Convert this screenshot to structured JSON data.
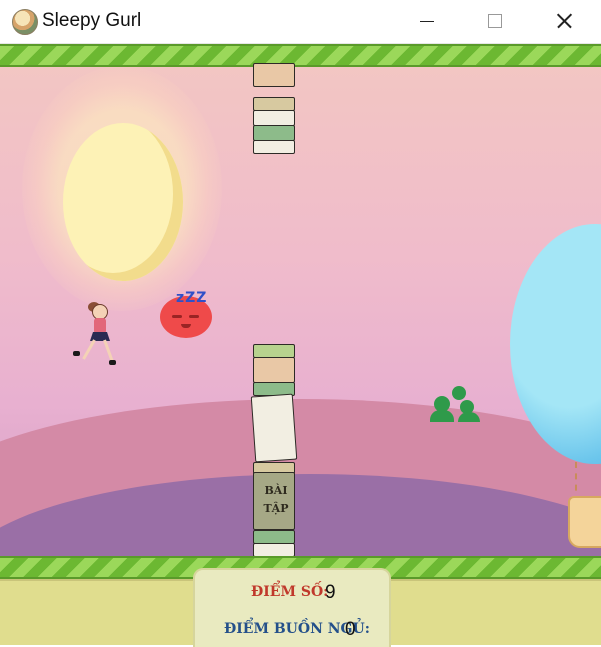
{
  "window": {
    "title": "Sleepy Gurl",
    "icon": "app-avatar-icon",
    "controls": [
      "minimize-icon",
      "maximize-icon",
      "close-icon"
    ]
  },
  "game": {
    "obstacle_sign": {
      "line1": "BÀI",
      "line2": "TẬP"
    },
    "sleep_bubble_text": "zZZ"
  },
  "hud": {
    "score_label": "ĐIỂM SỐ:",
    "score_value": "9",
    "sleep_label": "ĐIỂM BUỒN NGỦ:",
    "sleep_value": "0"
  },
  "colors": {
    "sky_top": "#f3c7c2",
    "sky_bottom": "#c494c4",
    "stripe_light": "#9bd85a",
    "stripe_dark": "#6cb832",
    "ground": "#e0dd8e",
    "score_label": "#c0392b",
    "sleep_label": "#24508a"
  }
}
